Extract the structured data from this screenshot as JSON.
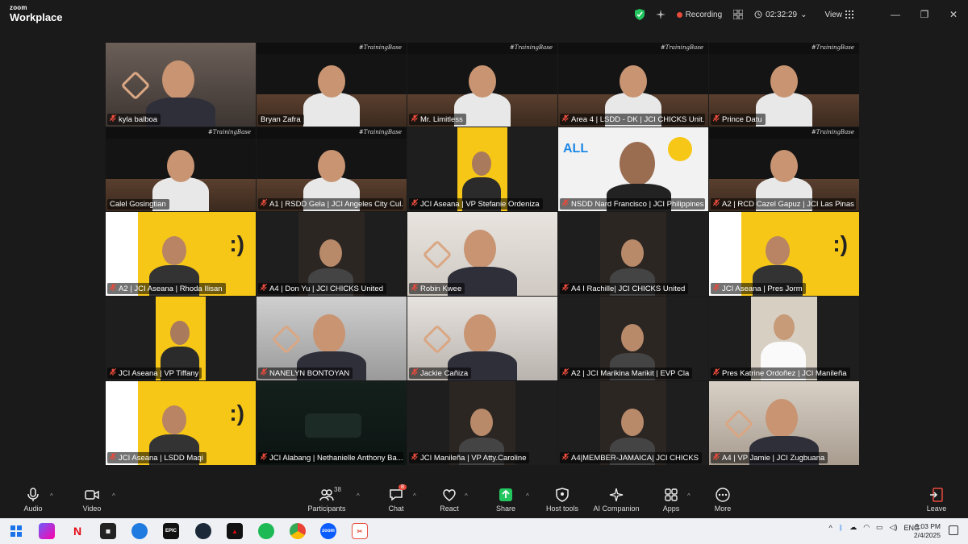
{
  "app": {
    "brand_small": "zoom",
    "brand_big": "Workplace",
    "recording_label": "Recording",
    "timer": "02:32:29",
    "view_label": "View"
  },
  "participants": [
    {
      "name": "kyla balboa",
      "muted": true
    },
    {
      "name": "Bryan Zafra",
      "muted": false,
      "active": true
    },
    {
      "name": "Mr. Limitless",
      "muted": true
    },
    {
      "name": "Area 4 | LSDD - DK | JCI CHICKS Unit...",
      "muted": true
    },
    {
      "name": "Prince Datu",
      "muted": true
    },
    {
      "name": "Calel Gosingtian",
      "muted": false
    },
    {
      "name": "A1 | RSDD Gela | JCI Angeles City Cul...",
      "muted": true
    },
    {
      "name": "JCI Aseana | VP Stefanie Ordeniza",
      "muted": true
    },
    {
      "name": "NSDD Nard Francisco | JCI Philippines",
      "muted": true
    },
    {
      "name": "A2 | RCD Cazel Gapuz | JCI Las Pinas Wat...",
      "muted": true
    },
    {
      "name": "A2 | JCI Aseana | Rhoda Ilisan",
      "muted": true
    },
    {
      "name": "A4 | Don Yu | JCI CHICKS United",
      "muted": true
    },
    {
      "name": "Robin Kwee",
      "muted": true
    },
    {
      "name": "A4 I Rachille| JCI CHICKS United",
      "muted": true
    },
    {
      "name": "JCI Aseana | Pres Jorm",
      "muted": true
    },
    {
      "name": "JCI Aseana | VP Tiffany",
      "muted": true
    },
    {
      "name": "NANELYN BONTOYAN",
      "muted": true
    },
    {
      "name": "Jackie Cañiza",
      "muted": true
    },
    {
      "name": "A2 | JCI Marikina Marikit | EVP Cla",
      "muted": true
    },
    {
      "name": "Pres Katrine Ordoñez | JCI Manileña",
      "muted": true
    },
    {
      "name": "JCI Aseana | LSDD Maqi",
      "muted": true
    },
    {
      "name": "JCI Alabang | Nethanielle Anthony Ba...",
      "muted": true
    },
    {
      "name": "JCI  Manileña | VP Atty.Caroline",
      "muted": true
    },
    {
      "name": "A4|MEMBER-JAMAICA| JCI CHICKS",
      "muted": true
    },
    {
      "name": "A4 | VP Jamie | JCI Zugbuana",
      "muted": true
    }
  ],
  "toolbar": {
    "audio": "Audio",
    "video": "Video",
    "participants": "Participants",
    "participants_count": "38",
    "chat": "Chat",
    "chat_badge": "8",
    "react": "React",
    "share": "Share",
    "host_tools": "Host tools",
    "ai_companion": "AI Companion",
    "apps": "Apps",
    "more": "More",
    "leave": "Leave"
  },
  "taskbar": {
    "lang": "ENG",
    "time": "9:03 PM",
    "date": "2/4/2025"
  },
  "colors": {
    "active_border": "#3ed17a",
    "muted_red": "#e74b3c",
    "brand_yellow": "#f7c718",
    "share_green": "#22c55e"
  }
}
